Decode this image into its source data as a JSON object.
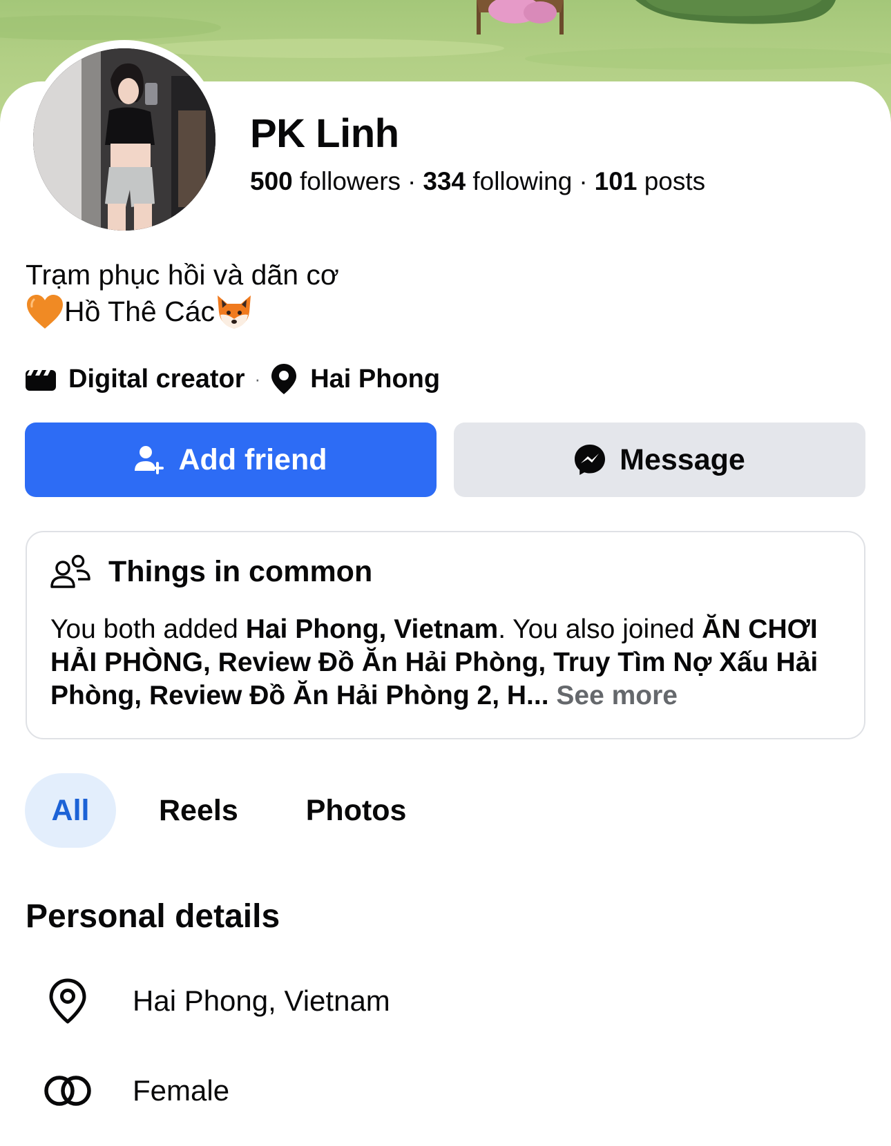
{
  "profile": {
    "name": "PK Linh",
    "followers_count": "500",
    "followers_label": "followers",
    "following_count": "334",
    "following_label": "following",
    "posts_count": "101",
    "posts_label": "posts",
    "separator": "·"
  },
  "bio": {
    "line1": "Trạm phục hồi và dãn cơ",
    "line2": "Hồ Thê Các",
    "line2_leading_icon": "orange-heart-emoji",
    "line2_trailing_icon": "fox-emoji"
  },
  "meta": {
    "category": "Digital creator",
    "category_icon": "clapperboard-icon",
    "separator": "·",
    "location": "Hai Phong",
    "location_icon": "location-pin-icon"
  },
  "actions": {
    "add_friend": "Add friend",
    "message": "Message"
  },
  "things_in_common": {
    "title": "Things in common",
    "text_1": "You both added ",
    "bold_1": "Hai Phong, Vietnam",
    "text_2": ". You also joined ",
    "bold_2": "ĂN CHƠI HẢI PHÒNG, Review Đồ Ăn Hải Phòng, Truy Tìm Nợ Xấu Hải Phòng, Review Đồ Ăn Hải Phòng 2, H...",
    "see_more": " See more"
  },
  "tabs": [
    {
      "label": "All",
      "selected": true
    },
    {
      "label": "Reels",
      "selected": false
    },
    {
      "label": "Photos",
      "selected": false
    }
  ],
  "personal_details": {
    "title": "Personal details",
    "items": [
      {
        "icon": "location-pin-outline-icon",
        "text": "Hai Phong, Vietnam"
      },
      {
        "icon": "gender-rings-icon",
        "text": "Female"
      }
    ]
  },
  "colors": {
    "accent": "#2d6cf5",
    "tab_selected_bg": "#e3eefc",
    "tab_selected_text": "#1c62d6",
    "secondary_button": "#e4e6eb",
    "muted_text": "#65686c"
  }
}
